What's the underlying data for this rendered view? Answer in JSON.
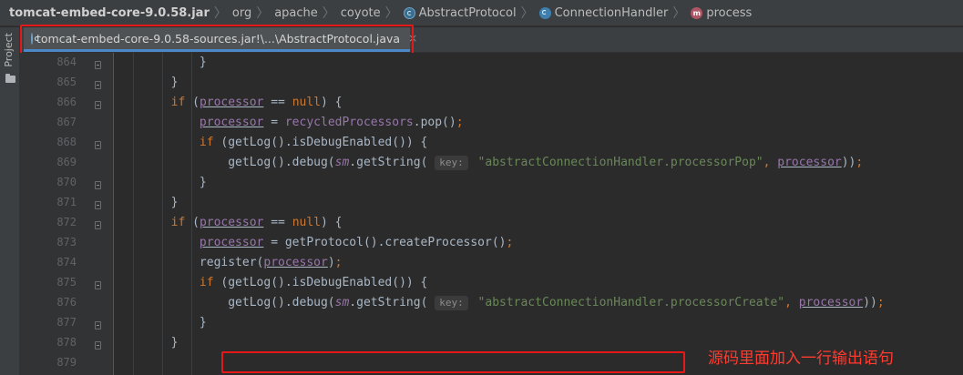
{
  "breadcrumb": {
    "items": [
      {
        "label": "tomcat-embed-core-9.0.58.jar",
        "icon": ""
      },
      {
        "label": "org",
        "icon": ""
      },
      {
        "label": "apache",
        "icon": ""
      },
      {
        "label": "coyote",
        "icon": ""
      },
      {
        "label": "AbstractProtocol",
        "icon": "abstract-class-icon"
      },
      {
        "label": "ConnectionHandler",
        "icon": "class-icon"
      },
      {
        "label": "process",
        "icon": "method-icon"
      }
    ]
  },
  "sidebar": {
    "project_label": "Project"
  },
  "tab": {
    "label": "tomcat-embed-core-9.0.58-sources.jar!\\...\\AbstractProtocol.java",
    "close": "×"
  },
  "editor": {
    "line_numbers": [
      "864",
      "865",
      "866",
      "867",
      "868",
      "869",
      "870",
      "871",
      "872",
      "873",
      "874",
      "875",
      "876",
      "877",
      "878",
      "879"
    ],
    "lines": [
      "            }",
      "        }",
      "        if (processor == null) {",
      "            processor = recycledProcessors.pop();",
      "            if (getLog().isDebugEnabled()) {",
      "                getLog().debug(sm.getString( key: \"abstractConnectionHandler.processorPop\", processor));",
      "            }",
      "        }",
      "        if (processor == null) {",
      "            processor = getProtocol().createProcessor();",
      "            register(processor);",
      "            if (getLog().isDebugEnabled()) {",
      "                getLog().debug(sm.getString( key: \"abstractConnectionHandler.processorCreate\", processor));",
      "            }",
      "        }",
      ""
    ],
    "hint_key": "key:"
  },
  "annotation": {
    "text": "源码里面加入一行输出语句"
  },
  "colors": {
    "highlight": "#e5191a",
    "accent": "#4a88c7"
  }
}
